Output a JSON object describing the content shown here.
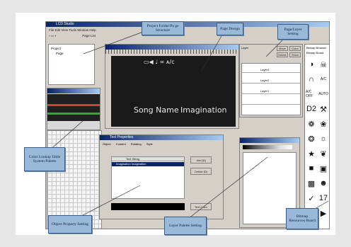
{
  "app": {
    "title": "LCD Studio",
    "menu": "File  Edit  View  Tools  Window  Help",
    "page_list_label": "Page List"
  },
  "project_tree": {
    "root": "Project",
    "child": "Page"
  },
  "page_design": {
    "song_name": "Song Name",
    "song_value": "Imagination",
    "top_icons": "▭◀ ♩ ∞ ᴀ/ᴄ"
  },
  "object_props": {
    "title": "Text Properties",
    "tabs": [
      "Object",
      "Content",
      "Rotating",
      "Style"
    ],
    "list_header": "Text String",
    "list_item": "Imagination  Imagination",
    "add_button": "Add [A]",
    "delete_button": "Delete [D]",
    "color_button": "Text Color"
  },
  "page_layer": {
    "header": "Layer",
    "rows": [
      "Layer3",
      "Layer2",
      "Layer1"
    ],
    "buttons": [
      "Move",
      "Color",
      "Delete",
      "Show"
    ]
  },
  "bitmap": {
    "header": "Bitmap Browser",
    "subheader": "Bitmap Board"
  },
  "callouts": {
    "project_folder": "Project Folder/Pa ge Structure",
    "page_design": "Page Design",
    "page_layer": "Page/Layer Setting",
    "color_lookup": "Color Lookup Table System Palette",
    "object_property": "Object Property Setting",
    "layer_palette": "Layer Palette Setting",
    "bitmap_board": "Bitmap Resources Board"
  },
  "bitmap_icons": [
    "◑",
    "☠",
    "∩",
    "A/C",
    "A/C OFF",
    "AUTO",
    "D2",
    "⚒",
    "❁",
    "❀",
    "❂",
    "☼",
    "★",
    "❦",
    "■",
    "▣",
    "▩",
    "☻",
    "✓",
    "17",
    "▼",
    "▶"
  ],
  "colors": {
    "callout_fill": "#9ab8d8",
    "callout_border": "#3e5d86",
    "titlebar": "#0a246a",
    "lcd_bg": "#1a1a1a"
  }
}
